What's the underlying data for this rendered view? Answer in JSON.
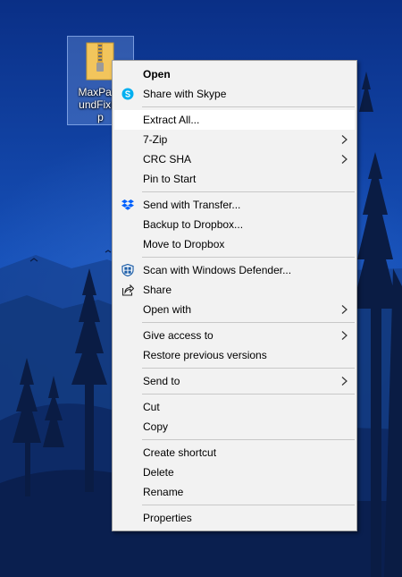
{
  "desktop": {
    "icon": {
      "label": "MaxPayn\nundFixFil\np",
      "icon_name": "zip-folder-icon"
    }
  },
  "menu": {
    "items": [
      {
        "label": "Open",
        "bold": true
      },
      {
        "label": "Share with Skype",
        "icon": "skype-icon"
      },
      {
        "label": "Extract All...",
        "highlighted": true
      },
      {
        "label": "7-Zip",
        "submenu": true
      },
      {
        "label": "CRC SHA",
        "submenu": true
      },
      {
        "label": "Pin to Start"
      },
      {
        "label": "Send with Transfer...",
        "icon": "dropbox-icon"
      },
      {
        "label": "Backup to Dropbox..."
      },
      {
        "label": "Move to Dropbox"
      },
      {
        "label": "Scan with Windows Defender...",
        "icon": "windows-defender-icon"
      },
      {
        "label": "Share",
        "icon": "share-icon"
      },
      {
        "label": "Open with",
        "submenu": true
      },
      {
        "label": "Give access to",
        "submenu": true
      },
      {
        "label": "Restore previous versions"
      },
      {
        "label": "Send to",
        "submenu": true
      },
      {
        "label": "Cut"
      },
      {
        "label": "Copy"
      },
      {
        "label": "Create shortcut"
      },
      {
        "label": "Delete"
      },
      {
        "label": "Rename"
      },
      {
        "label": "Properties"
      }
    ]
  },
  "colors": {
    "menu_background": "#f2f2f2",
    "highlight": "#ffffff",
    "separator": "#c8c8c8",
    "skype": "#00aff0",
    "dropbox": "#0061fe",
    "defender": "#1f5fa8"
  }
}
